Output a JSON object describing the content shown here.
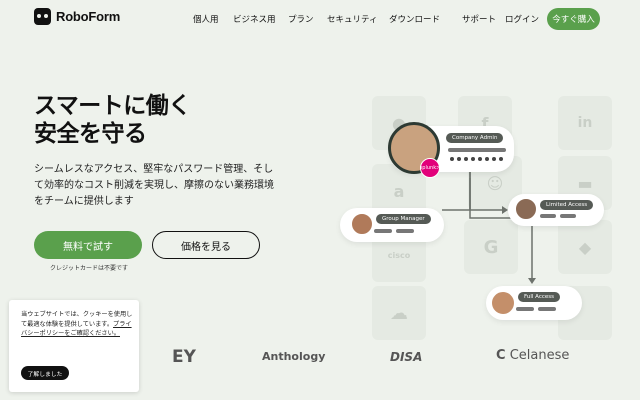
{
  "header": {
    "brand": "RoboForm",
    "nav": [
      "個人用",
      "ビジネス用",
      "プラン",
      "セキュリティ",
      "ダウンロード"
    ],
    "support": "サポート",
    "login": "ログイン",
    "cta": "今すぐ購入"
  },
  "hero": {
    "title_line1": "スマートに働く",
    "title_line2": "安全を守る",
    "description": "シームレスなアクセス、堅牢なパスワード管理、そして効率的なコスト削減を実現し、摩擦のない業務環境をチームに提供します",
    "primary_button": "無料で試す",
    "secondary_button": "価格を見る",
    "note": "クレジットカードは不要です"
  },
  "illustration": {
    "badge_text": "splunk>",
    "roles": [
      "Company Admin",
      "Group Manager",
      "Limited Access",
      "Full Access"
    ],
    "tile_icons": [
      "apple-icon",
      "figma-icon",
      "linkedin-icon",
      "amazon-icon",
      "mailchimp-icon",
      "chat-icon",
      "cisco-icon",
      "google-icon",
      "dropbox-icon",
      "cloud-icon"
    ],
    "tile_labels": [
      "cisco"
    ]
  },
  "brands": [
    "EY",
    "Anthology",
    "DISA",
    "Celanese"
  ],
  "cookie": {
    "text": "当ウェブサイトでは、クッキーを使用して最適な体験を提供しています。",
    "link": "プライバシーポリシーをご確認ください。",
    "button": "了解しました"
  },
  "colors": {
    "accent": "#5aa04c",
    "background": "#eef2ec"
  }
}
